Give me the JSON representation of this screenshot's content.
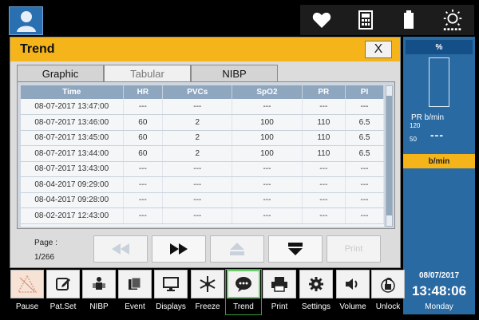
{
  "dialog": {
    "title": "Trend",
    "close_label": "X",
    "tabs": [
      {
        "label": "Graphic"
      },
      {
        "label": "Tabular"
      },
      {
        "label": "NIBP"
      }
    ],
    "table": {
      "headers": [
        "Time",
        "HR",
        "PVCs",
        "SpO2",
        "PR",
        "PI"
      ],
      "rows": [
        [
          "08-07-2017 13:47:00",
          "---",
          "---",
          "---",
          "---",
          "---"
        ],
        [
          "08-07-2017 13:46:00",
          "60",
          "2",
          "100",
          "110",
          "6.5"
        ],
        [
          "08-07-2017 13:45:00",
          "60",
          "2",
          "100",
          "110",
          "6.5"
        ],
        [
          "08-07-2017 13:44:00",
          "60",
          "2",
          "100",
          "110",
          "6.5"
        ],
        [
          "08-07-2017 13:43:00",
          "---",
          "---",
          "---",
          "---",
          "---"
        ],
        [
          "08-04-2017 09:29:00",
          "---",
          "---",
          "---",
          "---",
          "---"
        ],
        [
          "08-04-2017 09:28:00",
          "---",
          "---",
          "---",
          "---",
          "---"
        ],
        [
          "08-02-2017 12:43:00",
          "---",
          "---",
          "---",
          "---",
          "---"
        ]
      ]
    },
    "page_label": "Page :",
    "page_value": "1/266",
    "print_label": "Print"
  },
  "right_panel": {
    "top_label": "%",
    "pr_label": "PR   b/min",
    "pr_high": "120",
    "pr_low": "50",
    "pr_value": "---",
    "orange_label": "b/min",
    "date": "08/07/2017",
    "time": "13:48:06",
    "day": "Monday"
  },
  "toolbar": [
    {
      "label": "Pause",
      "icon": "pause-alarm-icon"
    },
    {
      "label": "Pat.Set",
      "icon": "edit-icon"
    },
    {
      "label": "NIBP",
      "icon": "nibp-icon"
    },
    {
      "label": "Event",
      "icon": "event-icon"
    },
    {
      "label": "Displays",
      "icon": "display-icon"
    },
    {
      "label": "Freeze",
      "icon": "freeze-icon"
    },
    {
      "label": "Trend",
      "icon": "trend-icon"
    },
    {
      "label": "Print",
      "icon": "printer-icon"
    },
    {
      "label": "Settings",
      "icon": "gear-icon"
    },
    {
      "label": "Volume",
      "icon": "volume-icon"
    },
    {
      "label": "Unlock",
      "icon": "unlock-icon"
    }
  ],
  "colors": {
    "accent": "#f4b41a",
    "panel_blue": "#2a6aa3",
    "active_green": "#6cd16c"
  }
}
